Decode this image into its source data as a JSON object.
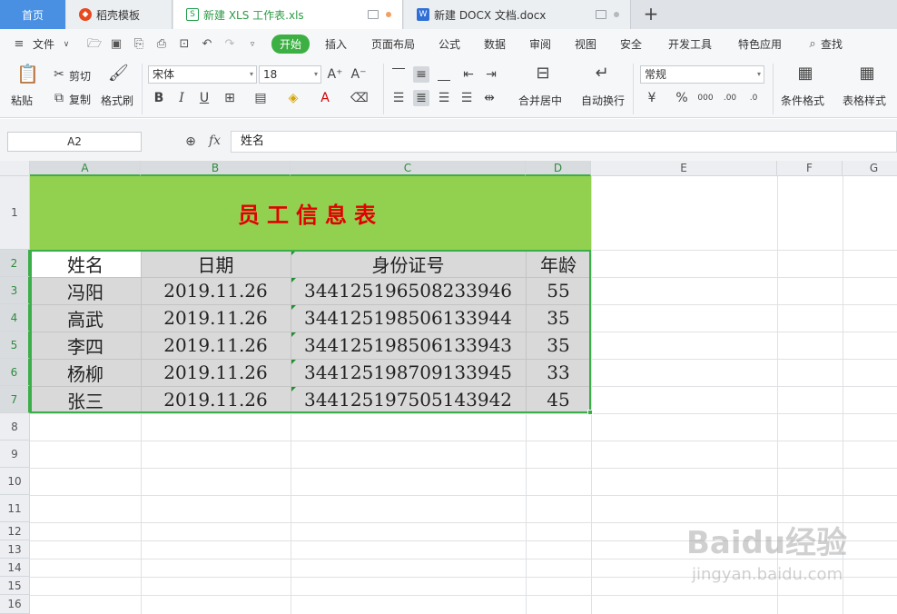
{
  "tabs": {
    "home": "首页",
    "items": [
      {
        "label": "稻壳模板",
        "icon": "docer-icon",
        "color": "#e8491d"
      },
      {
        "label": "新建 XLS 工作表.xls",
        "icon": "spreadsheet-icon",
        "color": "#1f9e4b"
      },
      {
        "label": "新建 DOCX 文档.docx",
        "icon": "word-icon",
        "color": "#2f6fd6"
      }
    ],
    "add": "+"
  },
  "menu": {
    "file": "文件",
    "items": [
      "开始",
      "插入",
      "页面布局",
      "公式",
      "数据",
      "审阅",
      "视图",
      "安全",
      "开发工具",
      "特色应用"
    ],
    "search": "查找"
  },
  "ribbon": {
    "paste": "粘贴",
    "cut": "剪切",
    "copy": "复制",
    "format_painter": "格式刷",
    "font_name": "宋体",
    "font_size": "18",
    "merge_center": "合并居中",
    "wrap_text": "自动换行",
    "number_format": "常规",
    "percent": "%",
    "conditional_format": "条件格式",
    "table_style": "表格样式"
  },
  "formula_bar": {
    "name_box": "A2",
    "fx": "fx",
    "content": "姓名"
  },
  "sheet": {
    "columns": [
      "A",
      "B",
      "C",
      "D",
      "E",
      "F",
      "G"
    ],
    "rows": [
      "1",
      "2",
      "3",
      "4",
      "5",
      "6",
      "7",
      "8",
      "9",
      "10",
      "11",
      "12",
      "13",
      "14",
      "15",
      "16"
    ],
    "title": "员工信息表",
    "headers": [
      "姓名",
      "日期",
      "身份证号",
      "年龄"
    ],
    "data": [
      [
        "冯阳",
        "2019.11.26",
        "344125196508233946",
        "55"
      ],
      [
        "高武",
        "2019.11.26",
        "344125198506133944",
        "35"
      ],
      [
        "李四",
        "2019.11.26",
        "344125198506133943",
        "35"
      ],
      [
        "杨柳",
        "2019.11.26",
        "344125198709133945",
        "33"
      ],
      [
        "张三",
        "2019.11.26",
        "344125197505143942",
        "45"
      ]
    ]
  },
  "watermark": {
    "main": "Baidu经验",
    "sub": "jingyan.baidu.com"
  }
}
